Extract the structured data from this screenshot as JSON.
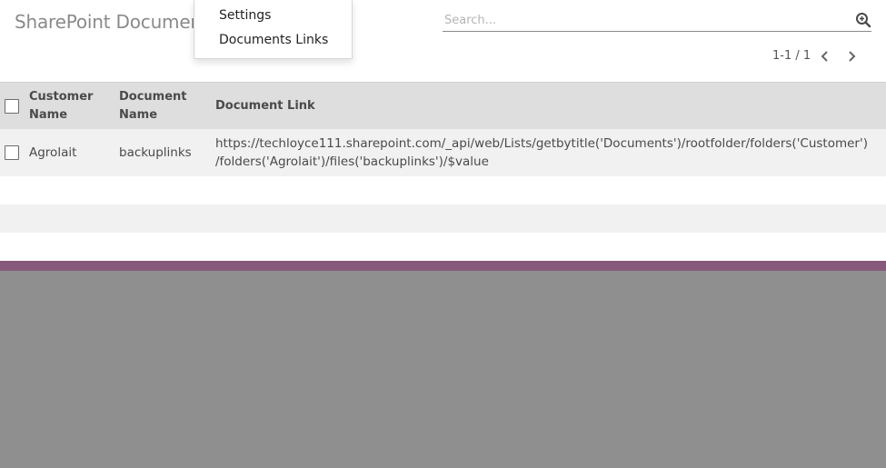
{
  "header": {
    "title": "SharePoint Document"
  },
  "menu": {
    "items": [
      {
        "label": "Settings"
      },
      {
        "label": "Documents Links"
      }
    ]
  },
  "search": {
    "value": "",
    "placeholder": "Search..."
  },
  "pager": {
    "text": "1-1 / 1"
  },
  "table": {
    "columns": {
      "customer_name_line1": "Customer",
      "customer_name_line2": "Name",
      "document_name_line1": "Document",
      "document_name_line2": "Name",
      "document_link": "Document Link"
    },
    "rows": [
      {
        "customer_name": "Agrolait",
        "document_name": "backuplinks",
        "document_link_line1": "https://techloyce111.sharepoint.com/_api/web/Lists/getbytitle('Documents')/rootfolder/folders('Customer')",
        "document_link_line2": "/folders('Agrolait')/files('backuplinks')/$value"
      }
    ]
  },
  "colors": {
    "brand": "#875a7b",
    "overlay": "#8f8f8f",
    "header_bg": "#dedede",
    "row_bg": "#f0f1f0"
  },
  "icons": {
    "search": "search-zoom-icon",
    "prev": "chevron-left-icon",
    "next": "chevron-right-icon"
  }
}
